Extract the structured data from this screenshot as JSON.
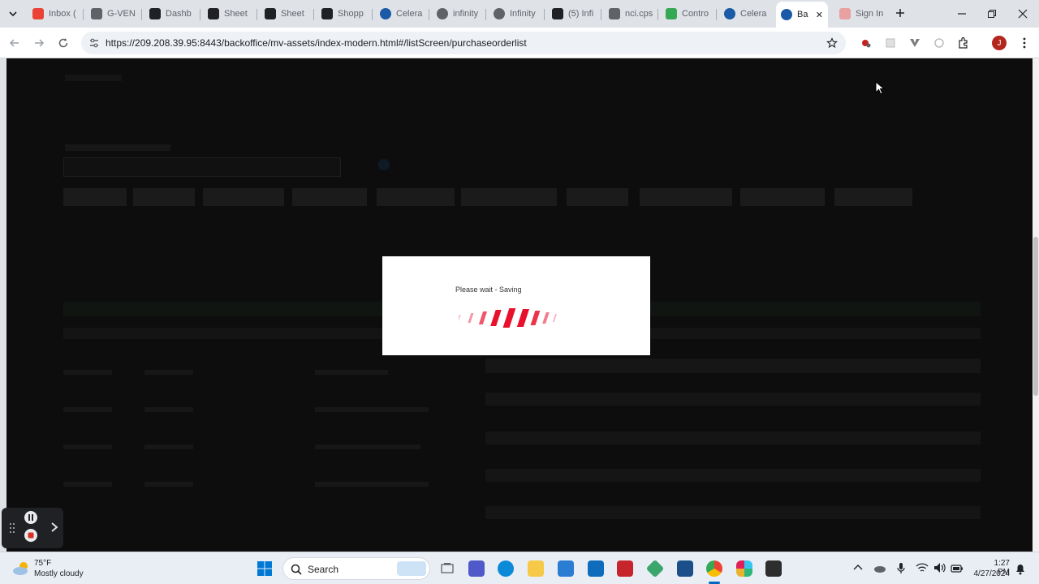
{
  "browser": {
    "tabs": [
      {
        "label": "Inbox (",
        "icon": "gmail-icon",
        "color": "#ea4335"
      },
      {
        "label": "G-VEN",
        "icon": "generic-icon",
        "color": "#5f6368"
      },
      {
        "label": "Dashb",
        "icon": "v-logo-icon",
        "color": "#202124"
      },
      {
        "label": "Sheet",
        "icon": "v-logo-icon",
        "color": "#202124"
      },
      {
        "label": "Sheet",
        "icon": "v-logo-icon",
        "color": "#202124"
      },
      {
        "label": "Shopp",
        "icon": "generic-icon",
        "color": "#202124"
      },
      {
        "label": "Celera",
        "icon": "globe-icon",
        "color": "#1a5aa6"
      },
      {
        "label": "infinity",
        "icon": "globe-icon",
        "color": "#5f6368"
      },
      {
        "label": "Infinity",
        "icon": "globe-icon",
        "color": "#5f6368"
      },
      {
        "label": "(5) Infi",
        "icon": "v-logo-icon",
        "color": "#202124"
      },
      {
        "label": "nci.cps",
        "icon": "doc-icon",
        "color": "#5f6368"
      },
      {
        "label": "Contro",
        "icon": "gear-icon",
        "color": "#34a853"
      },
      {
        "label": "Celera",
        "icon": "globe-icon",
        "color": "#1a5aa6"
      },
      {
        "label": "Ba",
        "icon": "globe-icon",
        "color": "#1a5aa6",
        "active": true
      },
      {
        "label": "Sign In",
        "icon": "generic-icon",
        "color": "#e8a0a0"
      }
    ],
    "url": "https://209.208.39.95:8443/backoffice/mv-assets/index-modern.html#/listScreen/purchaseorderlist",
    "profile_initial": "J"
  },
  "dialog": {
    "message": "Please wait - Saving",
    "spinner_color": "#e8112d"
  },
  "taskbar": {
    "weather_temp": "75°F",
    "weather_desc": "Mostly cloudy",
    "search_label": "Search",
    "time": "1:27 PM",
    "date": "4/27/2024"
  }
}
